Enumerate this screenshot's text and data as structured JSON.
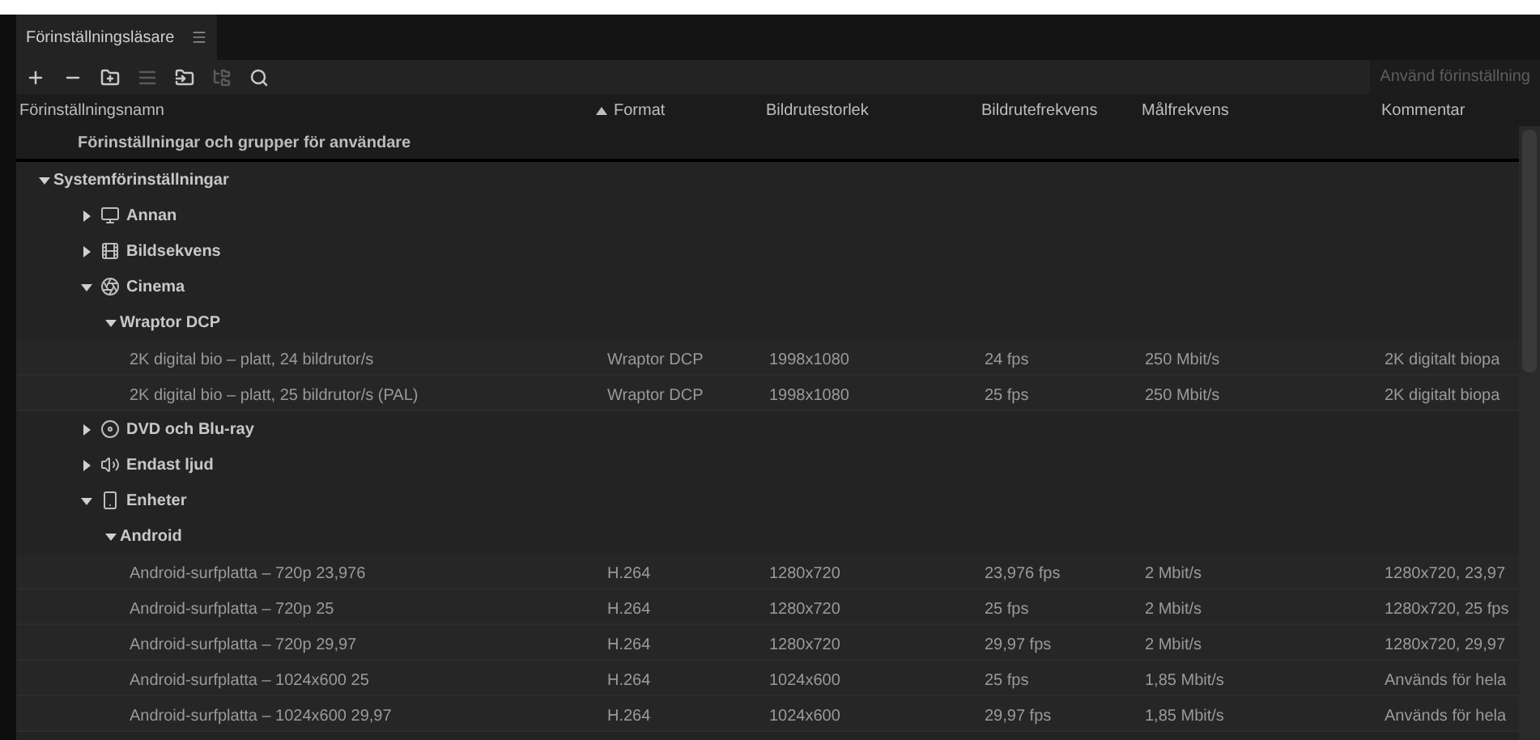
{
  "tab": {
    "label": "Förinställningsläsare",
    "selected": true
  },
  "toolbar": {
    "tools": [
      {
        "disabled": false
      },
      {
        "disabled": false
      },
      {
        "disabled": false
      },
      {
        "disabled": true
      },
      {
        "disabled": false
      },
      {
        "disabled": true
      },
      {
        "disabled": false
      }
    ],
    "apply_button": {
      "label": "Använd förinställning",
      "disabled": true
    }
  },
  "columns": [
    {
      "label": "Förinställningsnamn",
      "sorted": false
    },
    {
      "label": "Format",
      "sorted": true
    },
    {
      "label": "Bildrutestorlek",
      "sorted": false
    },
    {
      "label": "Bildrutefrekvens",
      "sorted": false
    },
    {
      "label": "Målfrekvens",
      "sorted": false
    },
    {
      "label": "Kommentar",
      "sorted": false
    }
  ],
  "tree": [
    {
      "kind": "root",
      "label": "Förinställningar och grupper för användare"
    },
    {
      "kind": "folder",
      "label": "Systemförinställningar",
      "expanded": true,
      "children": [
        {
          "kind": "category",
          "label": "Annan",
          "expanded": false
        },
        {
          "kind": "category",
          "label": "Bildsekvens",
          "expanded": false
        },
        {
          "kind": "category",
          "label": "Cinema",
          "expanded": true,
          "children": [
            {
              "kind": "folder",
              "label": "Wraptor DCP",
              "expanded": true,
              "children": [
                {
                  "kind": "preset",
                  "label": "2K digital bio – platt, 24 bildrutor/s",
                  "cells": [
                    "Wraptor DCP",
                    "1998x1080",
                    "24 fps",
                    "250 Mbit/s",
                    "2K digitalt biopa"
                  ]
                },
                {
                  "kind": "preset",
                  "label": "2K digital bio – platt, 25 bildrutor/s (PAL)",
                  "cells": [
                    "Wraptor DCP",
                    "1998x1080",
                    "25 fps",
                    "250 Mbit/s",
                    "2K digitalt biopa"
                  ]
                }
              ]
            }
          ]
        },
        {
          "kind": "category",
          "label": "DVD och Blu-ray",
          "expanded": false
        },
        {
          "kind": "category",
          "label": "Endast ljud",
          "expanded": false
        },
        {
          "kind": "category",
          "label": "Enheter",
          "expanded": true,
          "children": [
            {
              "kind": "folder",
              "label": "Android",
              "expanded": true,
              "children": [
                {
                  "kind": "preset",
                  "label": "Android-surfplatta – 720p 23,976",
                  "cells": [
                    "H.264",
                    "1280x720",
                    "23,976 fps",
                    "2 Mbit/s",
                    "1280x720, 23,97"
                  ]
                },
                {
                  "kind": "preset",
                  "label": "Android-surfplatta – 720p 25",
                  "cells": [
                    "H.264",
                    "1280x720",
                    "25 fps",
                    "2 Mbit/s",
                    "1280x720, 25 fps"
                  ]
                },
                {
                  "kind": "preset",
                  "label": "Android-surfplatta – 720p 29,97",
                  "cells": [
                    "H.264",
                    "1280x720",
                    "29,97 fps",
                    "2 Mbit/s",
                    "1280x720, 29,97"
                  ]
                },
                {
                  "kind": "preset",
                  "label": "Android-surfplatta – 1024x600 25",
                  "cells": [
                    "H.264",
                    "1024x600",
                    "25 fps",
                    "1,85 Mbit/s",
                    "Används för hela"
                  ]
                },
                {
                  "kind": "preset",
                  "label": "Android-surfplatta – 1024x600 29,97",
                  "cells": [
                    "H.264",
                    "1024x600",
                    "29,97 fps",
                    "1,85 Mbit/s",
                    "Används för hela"
                  ]
                }
              ]
            }
          ]
        }
      ]
    }
  ]
}
